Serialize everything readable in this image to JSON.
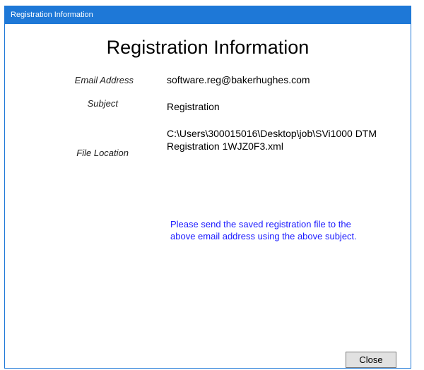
{
  "window": {
    "title": "Registration Information"
  },
  "header": {
    "title": "Registration Information"
  },
  "fields": {
    "email_label": "Email Address",
    "email_value": "software.reg@bakerhughes.com",
    "subject_label": "Subject",
    "subject_value": "Registration",
    "file_label": "File Location",
    "file_value_line1": "C:\\Users\\300015016\\Desktop\\job\\SVi1000 DTM",
    "file_value_line2": "Registration 1WJZ0F3.xml"
  },
  "note": {
    "text": "Please send the saved registration file to the above email address using the above subject."
  },
  "buttons": {
    "close_label": "Close"
  },
  "colors": {
    "titlebar": "#1e78d7",
    "note_text": "#1a1aff"
  }
}
